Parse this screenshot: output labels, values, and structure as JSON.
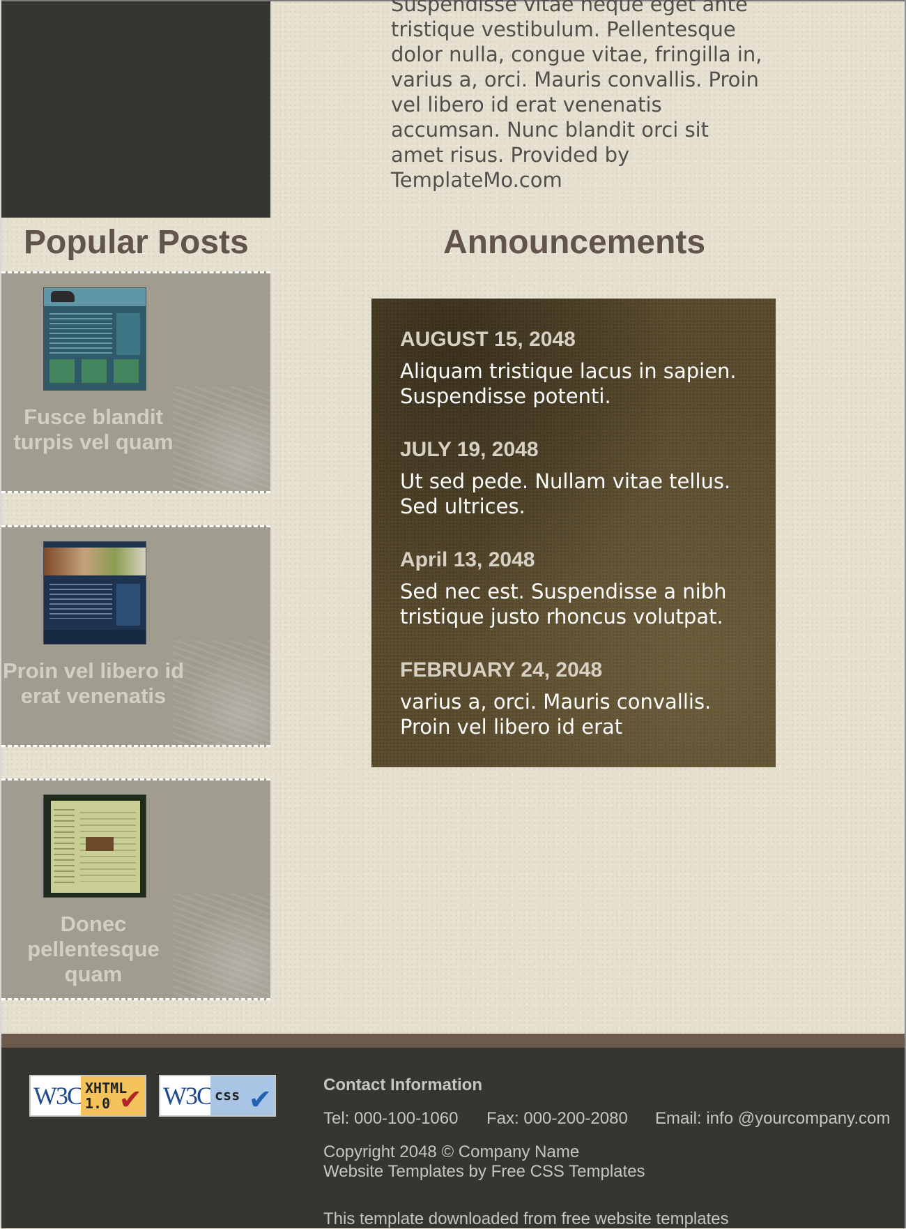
{
  "intro": {
    "text": "Suspendisse vitae neque eget ante tristique vestibulum. Pellentesque dolor nulla, congue vitae, fringilla in, varius a, orci. Mauris convallis. Proin vel libero id erat venenatis accumsan. Nunc blandit orci sit amet risus. Provided by TemplateMo.com"
  },
  "popular_posts": {
    "heading": "Popular Posts",
    "items": [
      {
        "title": "Fusce blandit turpis vel quam",
        "thumb_icon": "template-thumbnail-teal"
      },
      {
        "title": "Proin vel libero id erat venenatis",
        "thumb_icon": "template-thumbnail-navy"
      },
      {
        "title": "Donec pellentesque quam",
        "thumb_icon": "template-thumbnail-green"
      }
    ]
  },
  "announcements": {
    "heading": "Announcements",
    "items": [
      {
        "date": "AUGUST 15, 2048",
        "text": "Aliquam tristique lacus in sapien. Suspendisse potenti."
      },
      {
        "date": "JULY 19, 2048",
        "text": "Ut sed pede. Nullam vitae tellus. Sed ultrices."
      },
      {
        "date": "April 13, 2048",
        "text": "Sed nec est. Suspendisse a nibh tristique justo rhoncus volutpat."
      },
      {
        "date": "FEBRUARY 24, 2048",
        "text": "varius a, orci. Mauris convallis. Proin vel libero id erat"
      }
    ]
  },
  "footer": {
    "badges": [
      {
        "logo": "W3C",
        "label": "XHTML\n1.0",
        "check": "✔",
        "icon": "w3c-xhtml-valid-icon"
      },
      {
        "logo": "W3C",
        "label": "css",
        "check": "✔",
        "icon": "w3c-css-valid-icon"
      }
    ],
    "contact_title": "Contact Information",
    "tel": "Tel: 000-100-1060",
    "fax": "Fax: 000-200-2080",
    "email": "Email: info @yourcompany.com",
    "copyright": "Copyright 2048 © Company Name",
    "templates_credit": "Website Templates by Free CSS Templates",
    "downloaded": "This template downloaded from free website templates"
  },
  "colors": {
    "page_background": "#e6e0d1",
    "dark_panel": "#333631",
    "heading": "#625448",
    "post_card": "#a09d90",
    "announcement_box": "#5c4d2f",
    "footer_accent": "#6d5a4d",
    "footer_text": "#c7c5bd"
  }
}
